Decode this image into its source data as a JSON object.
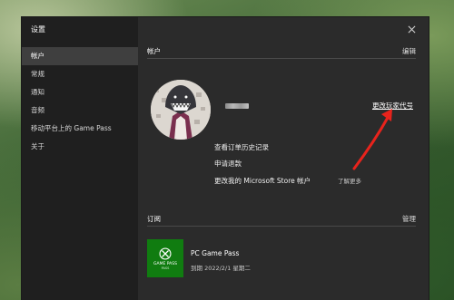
{
  "window": {
    "title": "设置"
  },
  "nav": {
    "items": [
      {
        "label": "帐户",
        "active": true
      },
      {
        "label": "常规",
        "active": false
      },
      {
        "label": "通知",
        "active": false
      },
      {
        "label": "音频",
        "active": false
      },
      {
        "label": "移动平台上的 Game Pass",
        "active": false
      },
      {
        "label": "关于",
        "active": false
      }
    ]
  },
  "account": {
    "title": "帐户",
    "edit_label": "编辑",
    "change_gamertag_label": "更改玩家代号",
    "links": [
      "查看订单历史记录",
      "申请退款",
      "更改我的 Microsoft Store 帐户"
    ],
    "learn_more_label": "了解更多"
  },
  "subscriptions": {
    "title": "订阅",
    "manage_label": "管理",
    "items": [
      {
        "logo_text": "GAME PASS",
        "logo_sub": "PASS",
        "name": "PC Game Pass",
        "renewal": "到期 2022/2/1 星期二"
      }
    ]
  },
  "colors": {
    "accent_green": "#107c10",
    "annotation_red": "#e8231c"
  },
  "icons": {
    "close": "close-icon",
    "xbox": "xbox-logo-icon"
  }
}
